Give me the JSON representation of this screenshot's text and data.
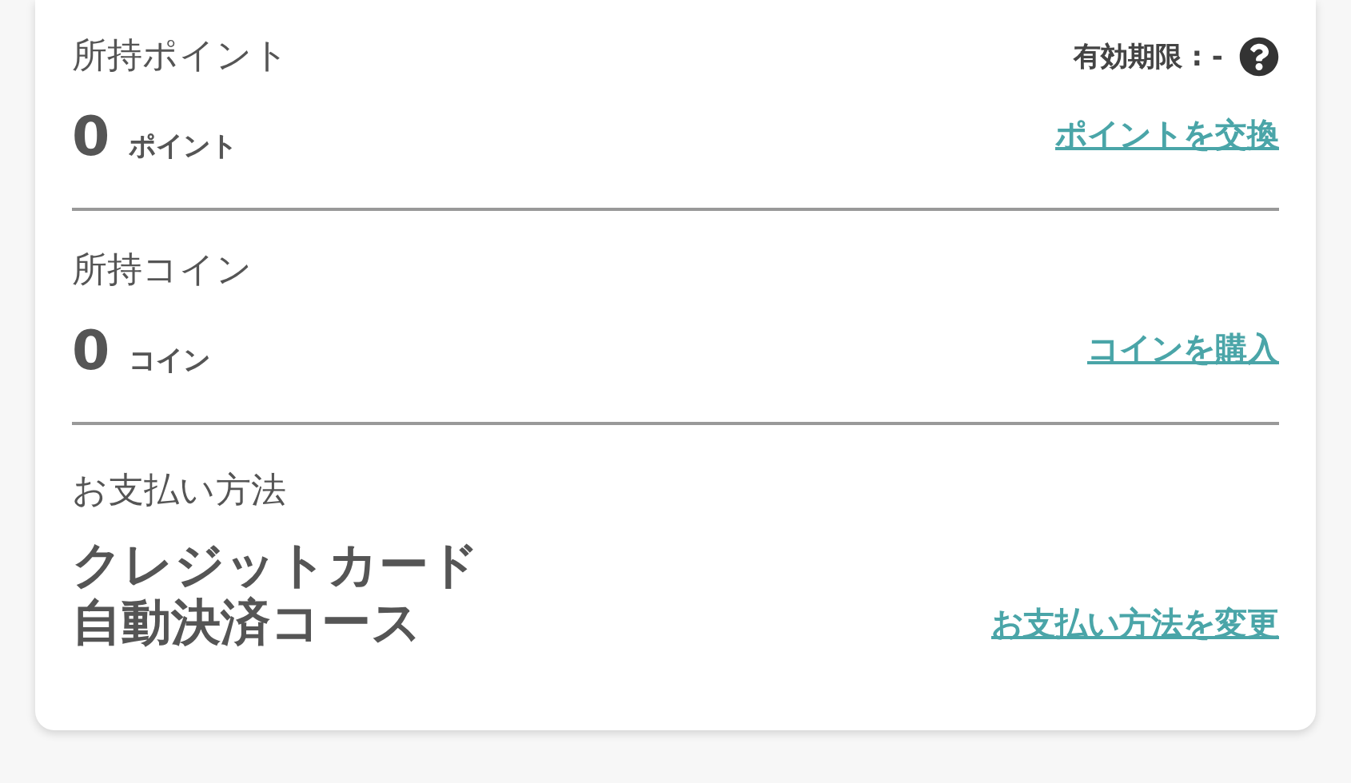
{
  "sections": [
    {
      "kind": "balance",
      "label": "所持ポイント",
      "expiry": "有効期限 : -",
      "amount": "0",
      "unit": "ポイント",
      "link": "ポイントを交換"
    },
    {
      "kind": "balance",
      "label": "所持コイン",
      "amount": "0",
      "unit": "コイン",
      "link": "コインを購入"
    },
    {
      "kind": "payment",
      "label": "お支払い方法",
      "value_lines": [
        "クレジットカード",
        "自動決済コース"
      ],
      "link": "お支払い方法を変更"
    }
  ]
}
